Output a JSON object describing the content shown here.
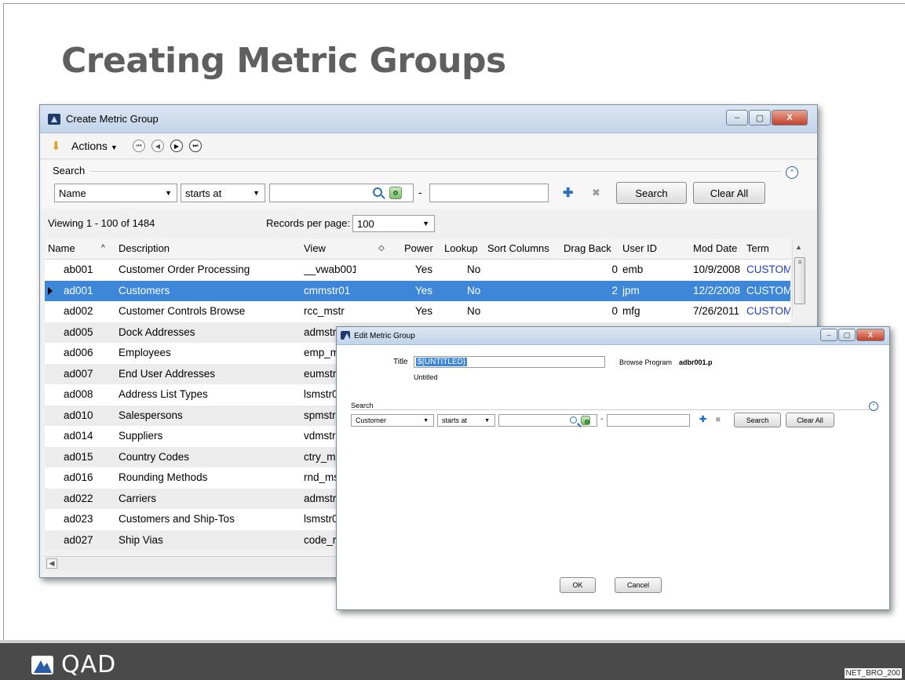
{
  "slide": {
    "title": "Creating Metric Groups",
    "footer_logo": "QAD",
    "footer_code": "NET_BRO_200"
  },
  "main_window": {
    "title": "Create Metric Group",
    "buttons": {
      "minimize": "–",
      "restore": "▢",
      "close": "X"
    },
    "toolbar": {
      "actions_label": "Actions"
    },
    "search": {
      "label": "Search",
      "field": "Name",
      "operator": "starts at",
      "value": "",
      "separator": "-",
      "search_label": "Search",
      "clear_label": "Clear All"
    },
    "viewing": "Viewing 1 - 100 of 1484",
    "records_per_page_label": "Records per page:",
    "records_per_page": "100",
    "columns": [
      "Name",
      "Description",
      "View",
      "Power",
      "Lookup",
      "Sort Columns",
      "Drag Back",
      "User ID",
      "Mod Date",
      "Term"
    ],
    "rows": [
      {
        "name": "ab001",
        "description": "Customer Order Processing",
        "view": "__vwab001",
        "power": "Yes",
        "lookup": "No",
        "drag_back": "0",
        "user_id": "emb",
        "mod_date": "10/9/2008",
        "term": "CUSTOM"
      },
      {
        "name": "ad001",
        "description": "Customers",
        "view": "cmmstr01",
        "power": "Yes",
        "lookup": "No",
        "drag_back": "2",
        "user_id": "jpm",
        "mod_date": "12/2/2008",
        "term": "CUSTOM"
      },
      {
        "name": "ad002",
        "description": "Customer Controls Browse",
        "view": "rcc_mstr",
        "power": "Yes",
        "lookup": "No",
        "drag_back": "0",
        "user_id": "mfg",
        "mod_date": "7/26/2011",
        "term": "CUSTOM"
      },
      {
        "name": "ad005",
        "description": "Dock Addresses",
        "view": "admstr",
        "power": "",
        "lookup": "",
        "drag_back": "",
        "user_id": "",
        "mod_date": "",
        "term": ""
      },
      {
        "name": "ad006",
        "description": "Employees",
        "view": "emp_m",
        "power": "",
        "lookup": "",
        "drag_back": "",
        "user_id": "",
        "mod_date": "",
        "term": ""
      },
      {
        "name": "ad007",
        "description": "End User Addresses",
        "view": "eumstr",
        "power": "",
        "lookup": "",
        "drag_back": "",
        "user_id": "",
        "mod_date": "",
        "term": ""
      },
      {
        "name": "ad008",
        "description": "Address List Types",
        "view": "lsmstr0",
        "power": "",
        "lookup": "",
        "drag_back": "",
        "user_id": "",
        "mod_date": "",
        "term": ""
      },
      {
        "name": "ad010",
        "description": "Salespersons",
        "view": "spmstr",
        "power": "",
        "lookup": "",
        "drag_back": "",
        "user_id": "",
        "mod_date": "",
        "term": ""
      },
      {
        "name": "ad014",
        "description": "Suppliers",
        "view": "vdmstr",
        "power": "",
        "lookup": "",
        "drag_back": "",
        "user_id": "",
        "mod_date": "",
        "term": ""
      },
      {
        "name": "ad015",
        "description": "Country Codes",
        "view": "ctry_m",
        "power": "",
        "lookup": "",
        "drag_back": "",
        "user_id": "",
        "mod_date": "",
        "term": ""
      },
      {
        "name": "ad016",
        "description": "Rounding Methods",
        "view": "rnd_ms",
        "power": "",
        "lookup": "",
        "drag_back": "",
        "user_id": "",
        "mod_date": "",
        "term": ""
      },
      {
        "name": "ad022",
        "description": "Carriers",
        "view": "admstr",
        "power": "",
        "lookup": "",
        "drag_back": "",
        "user_id": "",
        "mod_date": "",
        "term": ""
      },
      {
        "name": "ad023",
        "description": "Customers and Ship-Tos",
        "view": "lsmstr0",
        "power": "",
        "lookup": "",
        "drag_back": "",
        "user_id": "",
        "mod_date": "",
        "term": ""
      },
      {
        "name": "ad027",
        "description": "Ship Vias",
        "view": "code_r",
        "power": "",
        "lookup": "",
        "drag_back": "",
        "user_id": "",
        "mod_date": "",
        "term": ""
      }
    ],
    "selected_row_index": 1
  },
  "edit_window": {
    "title": "Edit Metric Group",
    "title_label": "Title",
    "title_value": "${UNTITLED}",
    "title_display": "Untitled",
    "browse_program_label": "Browse Program",
    "browse_program": "adbr001.p",
    "search": {
      "label": "Search",
      "field": "Customer",
      "operator": "starts at",
      "separator": "-",
      "search_label": "Search",
      "clear_label": "Clear All"
    },
    "ok_label": "OK",
    "cancel_label": "Cancel"
  },
  "colors": {
    "selection": "#3d86d8",
    "term_link": "#1f3ec6",
    "title_gray": "#5f5f5f",
    "footer": "#4a4a4a"
  }
}
